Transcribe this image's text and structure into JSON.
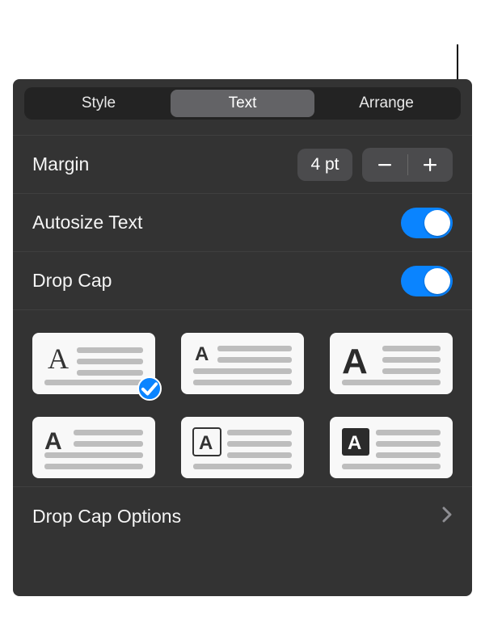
{
  "tabs": {
    "style": "Style",
    "text": "Text",
    "arrange": "Arrange",
    "active": "text"
  },
  "margin": {
    "label": "Margin",
    "value": "4 pt"
  },
  "autosize": {
    "label": "Autosize Text",
    "on": true
  },
  "dropcap": {
    "label": "Drop Cap",
    "on": true
  },
  "dropcap_styles": {
    "selected_index": 0,
    "items": [
      {
        "name": "style-1"
      },
      {
        "name": "style-2"
      },
      {
        "name": "style-3"
      },
      {
        "name": "style-4"
      },
      {
        "name": "style-5"
      },
      {
        "name": "style-6"
      }
    ]
  },
  "options_link": "Drop Cap Options"
}
